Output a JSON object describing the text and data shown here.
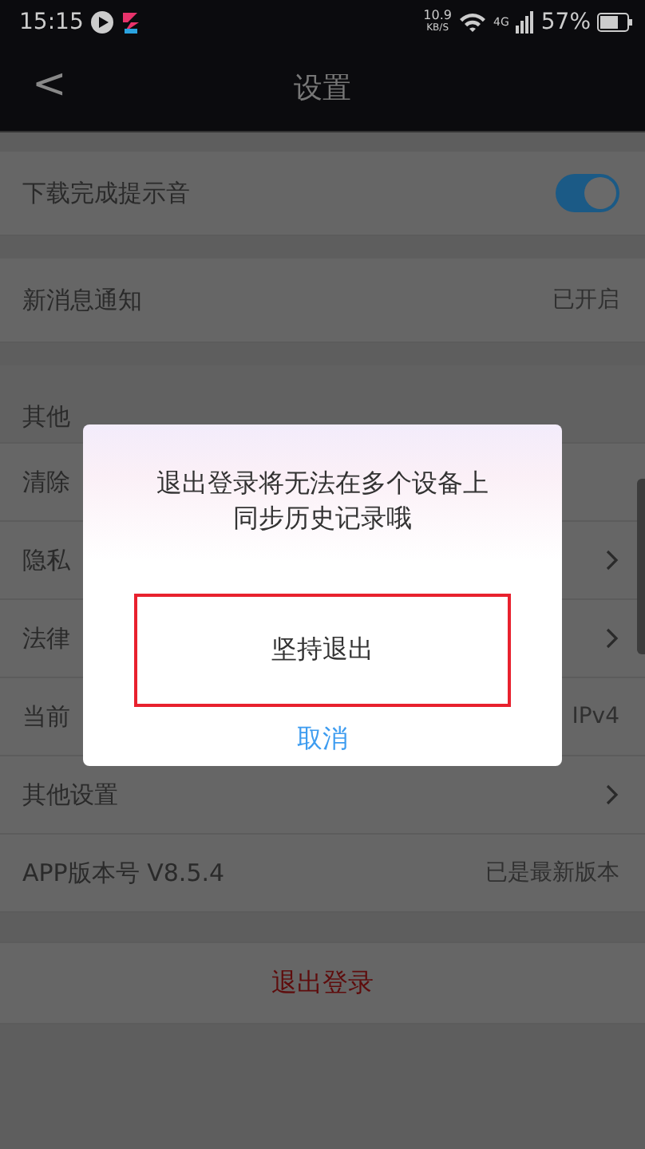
{
  "status_bar": {
    "time": "15:15",
    "speed": "10.9",
    "speed_unit": "KB/S",
    "network": "4G",
    "battery": "57%"
  },
  "nav": {
    "back": "<",
    "title": "设置"
  },
  "rows": [
    {
      "kind": "toggle",
      "label": "下载完成提示音",
      "on": true
    },
    {
      "kind": "value",
      "label": "新消息通知",
      "value": "已开启"
    },
    {
      "kind": "header",
      "label": "其他"
    },
    {
      "kind": "link",
      "label": "清除"
    },
    {
      "kind": "link",
      "label": "隐私",
      "chevron": true
    },
    {
      "kind": "link",
      "label": "法律",
      "chevron": true
    },
    {
      "kind": "value",
      "label": "当前",
      "value": "IPv4"
    },
    {
      "kind": "link",
      "label": "其他设置",
      "chevron": true
    },
    {
      "kind": "value",
      "label": "APP版本号  V8.5.4",
      "value": "已是最新版本"
    }
  ],
  "logout": "退出登录",
  "dialog": {
    "message": "退出登录将无法在多个设备上同步历史记录哦",
    "confirm": "坚持退出",
    "cancel": "取消"
  }
}
